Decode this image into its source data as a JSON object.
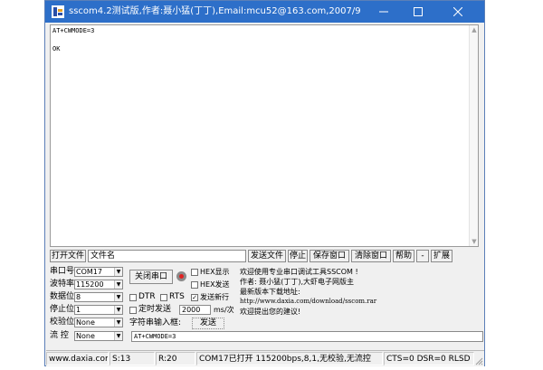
{
  "window": {
    "title": "sscom4.2测试版,作者:聂小猛(丁丁),Email:mcu52@163.com,2007/9"
  },
  "terminal": {
    "lines": "AT+CWMODE=3\n\nOK"
  },
  "file_row": {
    "open_file_label": "打开文件",
    "file_name_value": "文件名",
    "send_file_label": "发送文件",
    "stop_label": "停止",
    "save_window_label": "保存窗口",
    "clear_window_label": "清除窗口",
    "help_label": "帮助",
    "dash_label": "-",
    "expand_label": "扩展"
  },
  "serial": {
    "port_label": "串口号",
    "port_value": "COM17",
    "baud_label": "波特率",
    "baud_value": "115200",
    "databits_label": "数据位",
    "databits_value": "8",
    "stopbits_label": "停止位",
    "stopbits_value": "1",
    "parity_label": "校验位",
    "parity_value": "None",
    "flow_label": "流 控",
    "flow_value": "None",
    "close_port_label": "关闭串口"
  },
  "options": {
    "hex_display_label": "HEX显示",
    "hex_send_label": "HEX发送",
    "dtr_label": "DTR",
    "rts_label": "RTS",
    "newline_label": "发送新行",
    "timed_send_label": "定时发送",
    "interval_value": "2000",
    "interval_unit": "ms/次",
    "char_input_label": "字符串输入框:",
    "send_label": "发送",
    "send_value": "AT+CWMODE=3"
  },
  "info": {
    "line1": "欢迎使用专业串口调试工具SSCOM !",
    "line2": "作者: 聂小猛(丁丁),大虾电子网版主",
    "line3": "最新版本下载地址:",
    "line4": "http://www.daxia.com/download/sscom.rar",
    "line5": "欢迎提出您的建议!"
  },
  "status": {
    "site": "www.daxia.com",
    "s": "S:13",
    "r": "R:20",
    "port_state": "COM17已打开  115200bps,8,1,无校验,无流控",
    "signals": "CTS=0 DSR=0 RLSD"
  },
  "icons": {
    "app": "sscom-app-icon",
    "minimize": "minimize-icon",
    "maximize": "maximize-icon",
    "close": "close-icon",
    "check": "checkmark-icon"
  },
  "colors": {
    "titlebar": "#2d6fc9",
    "indicator": "#e02020"
  }
}
